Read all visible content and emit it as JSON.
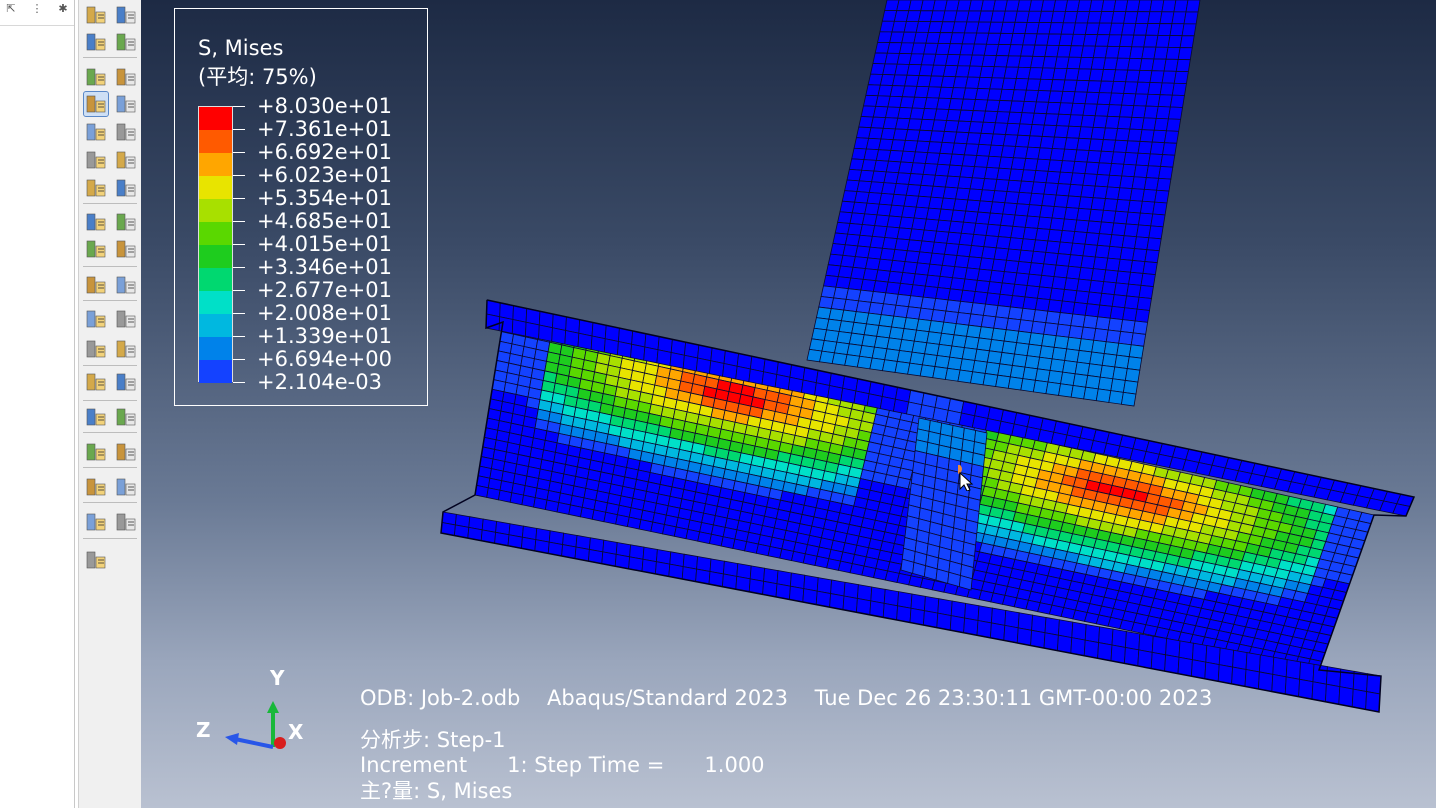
{
  "legend": {
    "title": "S, Mises",
    "subtitle": "(平均: 75%)",
    "values": [
      "+8.030e+01",
      "+7.361e+01",
      "+6.692e+01",
      "+6.023e+01",
      "+5.354e+01",
      "+4.685e+01",
      "+4.015e+01",
      "+3.346e+01",
      "+2.677e+01",
      "+2.008e+01",
      "+1.339e+01",
      "+6.694e+00",
      "+2.104e-03"
    ],
    "colors": [
      "#ff0000",
      "#ff5a00",
      "#ffa600",
      "#e8e400",
      "#a8e000",
      "#5ad800",
      "#1ecc1e",
      "#00d870",
      "#00e0c8",
      "#00b8e0",
      "#0082ea",
      "#1442ff",
      "#0000ff"
    ]
  },
  "info": {
    "odb_line": "ODB: Job-2.odb    Abaqus/Standard 2023    Tue Dec 26 23:30:11 GMT-00:00 2023",
    "step_line": "分析步: Step-1",
    "increment_line": "Increment      1: Step Time =      1.000",
    "variable_line": "主?量: S, Mises"
  },
  "triad": {
    "y": "Y",
    "z": "Z",
    "x": "X"
  },
  "toolbox": {
    "left_tools": [
      "query-numbering-icon",
      "deformed-shape-icon",
      "contour-icon",
      "symbol-icon",
      "material-orientation-icon",
      "animate-icon",
      "animate-time-history-icon",
      "animate-scale-icon",
      "xy-data-icon",
      "xy-table-icon",
      "path-icon",
      "probe-icon",
      "stream-icon",
      "display-group-icon",
      "view-cut-icon",
      "free-body-icon",
      "isosurface-icon",
      "sketch-edit-icon"
    ]
  },
  "colors": {
    "viewport_top": "#1d2a44",
    "viewport_bottom": "#b9c1d1",
    "mesh_line": "#0a0a30"
  }
}
